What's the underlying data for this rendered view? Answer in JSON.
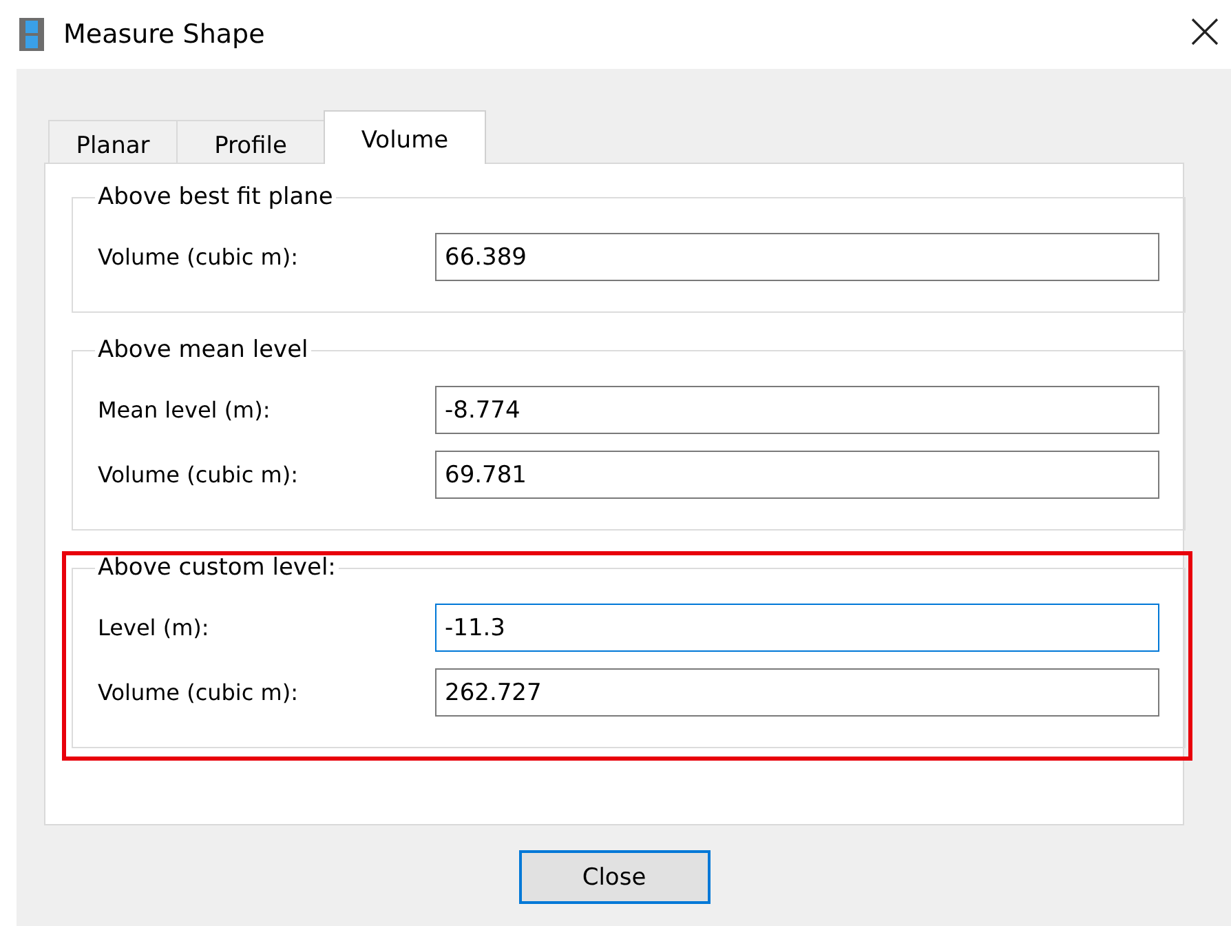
{
  "window": {
    "title": "Measure Shape"
  },
  "tabs": [
    {
      "label": "Planar",
      "selected": false
    },
    {
      "label": "Profile",
      "selected": false
    },
    {
      "label": "Volume",
      "selected": true
    }
  ],
  "groups": [
    {
      "title": "Above best fit plane",
      "highlighted": false,
      "fields": [
        {
          "label": "Volume (cubic m):",
          "value": "66.389",
          "focused": false
        }
      ]
    },
    {
      "title": "Above mean level",
      "highlighted": false,
      "fields": [
        {
          "label": "Mean level (m):",
          "value": "-8.774",
          "focused": false
        },
        {
          "label": "Volume (cubic m):",
          "value": "69.781",
          "focused": false
        }
      ]
    },
    {
      "title": "Above custom level:",
      "highlighted": true,
      "fields": [
        {
          "label": "Level (m):",
          "value": "-11.3",
          "focused": true
        },
        {
          "label": "Volume (cubic m):",
          "value": "262.727",
          "focused": false
        }
      ]
    }
  ],
  "buttons": [
    {
      "label": "Close"
    }
  ]
}
